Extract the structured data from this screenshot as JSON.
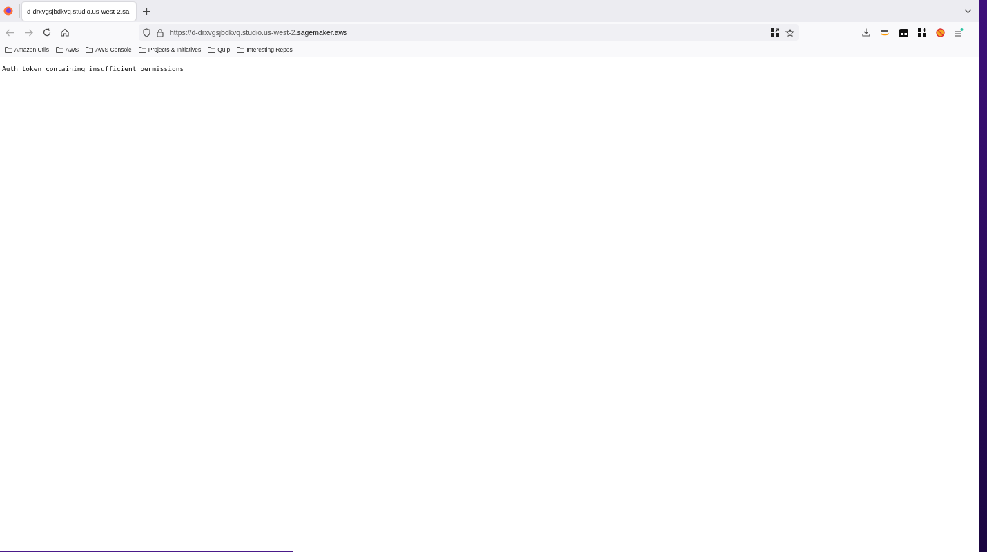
{
  "tabs": [
    {
      "title": "d-drxvgsjbdkvq.studio.us-west-2.sa",
      "selected": true
    }
  ],
  "address_bar": {
    "url_prefix": "https://d-drxvgsjbdkvq.studio.us-west-2.",
    "url_domain": "sagemaker.aws"
  },
  "bookmarks": [
    "Amazon Utils",
    "AWS",
    "AWS Console",
    "Projects & Initiatives",
    "Quip",
    "Interesting Repos"
  ],
  "page": {
    "message": "Auth token containing insufficient permissions"
  }
}
